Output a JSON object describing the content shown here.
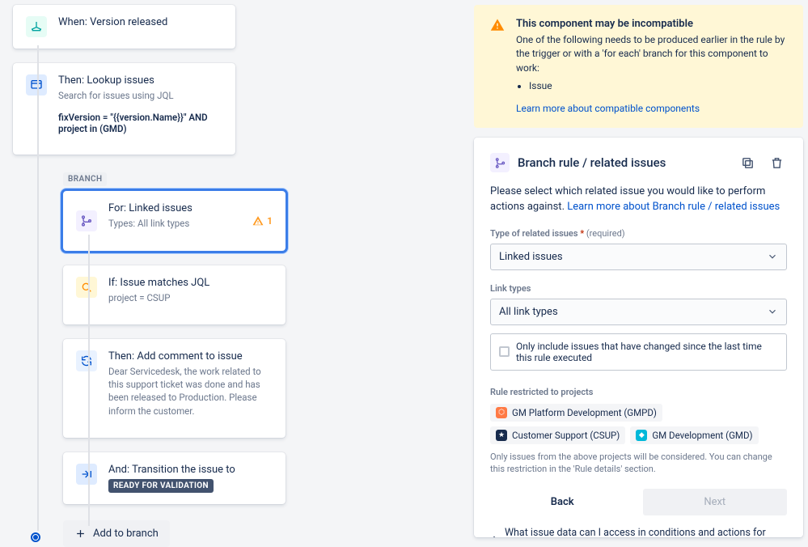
{
  "tree": {
    "trigger": {
      "title": "When: Version released"
    },
    "lookup": {
      "title": "Then: Lookup issues",
      "sub": "Search for issues using JQL",
      "jql": "fixVersion = \"{{version.Name}}\" AND project in (GMD)"
    },
    "branch_label": "BRANCH",
    "branch": {
      "title": "For: Linked issues",
      "sub": "Types: All link types",
      "warn_count": "1"
    },
    "cond": {
      "title": "If: Issue matches JQL",
      "jql": "project = CSUP"
    },
    "comment": {
      "title": "Then: Add comment to issue",
      "sub": "Dear Servicedesk, the work related to this support ticket was done and has been released to Production. Please inform the customer."
    },
    "transition": {
      "title": "And: Transition the issue to",
      "status": "READY FOR VALIDATION"
    },
    "add_branch": "Add to branch"
  },
  "warn": {
    "title": "This component may be incompatible",
    "desc": "One of the following needs to be produced earlier in the rule by the trigger or with a 'for each' branch for this component to work:",
    "items": [
      "Issue"
    ],
    "link": "Learn more about compatible components"
  },
  "panel": {
    "title": "Branch rule / related issues",
    "desc_lead": "Please select which related issue you would like to perform actions against. ",
    "desc_link": "Learn more about Branch rule / related issues",
    "type_label": "Type of related issues",
    "required": "(required)",
    "type_value": "Linked issues",
    "link_types_label": "Link types",
    "link_types_value": "All link types",
    "cb_label": "Only include issues that have changed since the last time this rule executed",
    "restrict_label": "Rule restricted to projects",
    "projects": [
      {
        "name": "GM Platform Development (GMPD)",
        "color": "orange"
      },
      {
        "name": "Customer Support (CSUP)",
        "color": "black"
      },
      {
        "name": "GM Development (GMD)",
        "color": "cyan"
      }
    ],
    "restrict_hint": "Only issues from the above projects will be considered. You can change this restriction in the 'Rule details' section.",
    "back": "Back",
    "next": "Next",
    "expander": "What issue data can I access in conditions and actions for related issues?"
  }
}
